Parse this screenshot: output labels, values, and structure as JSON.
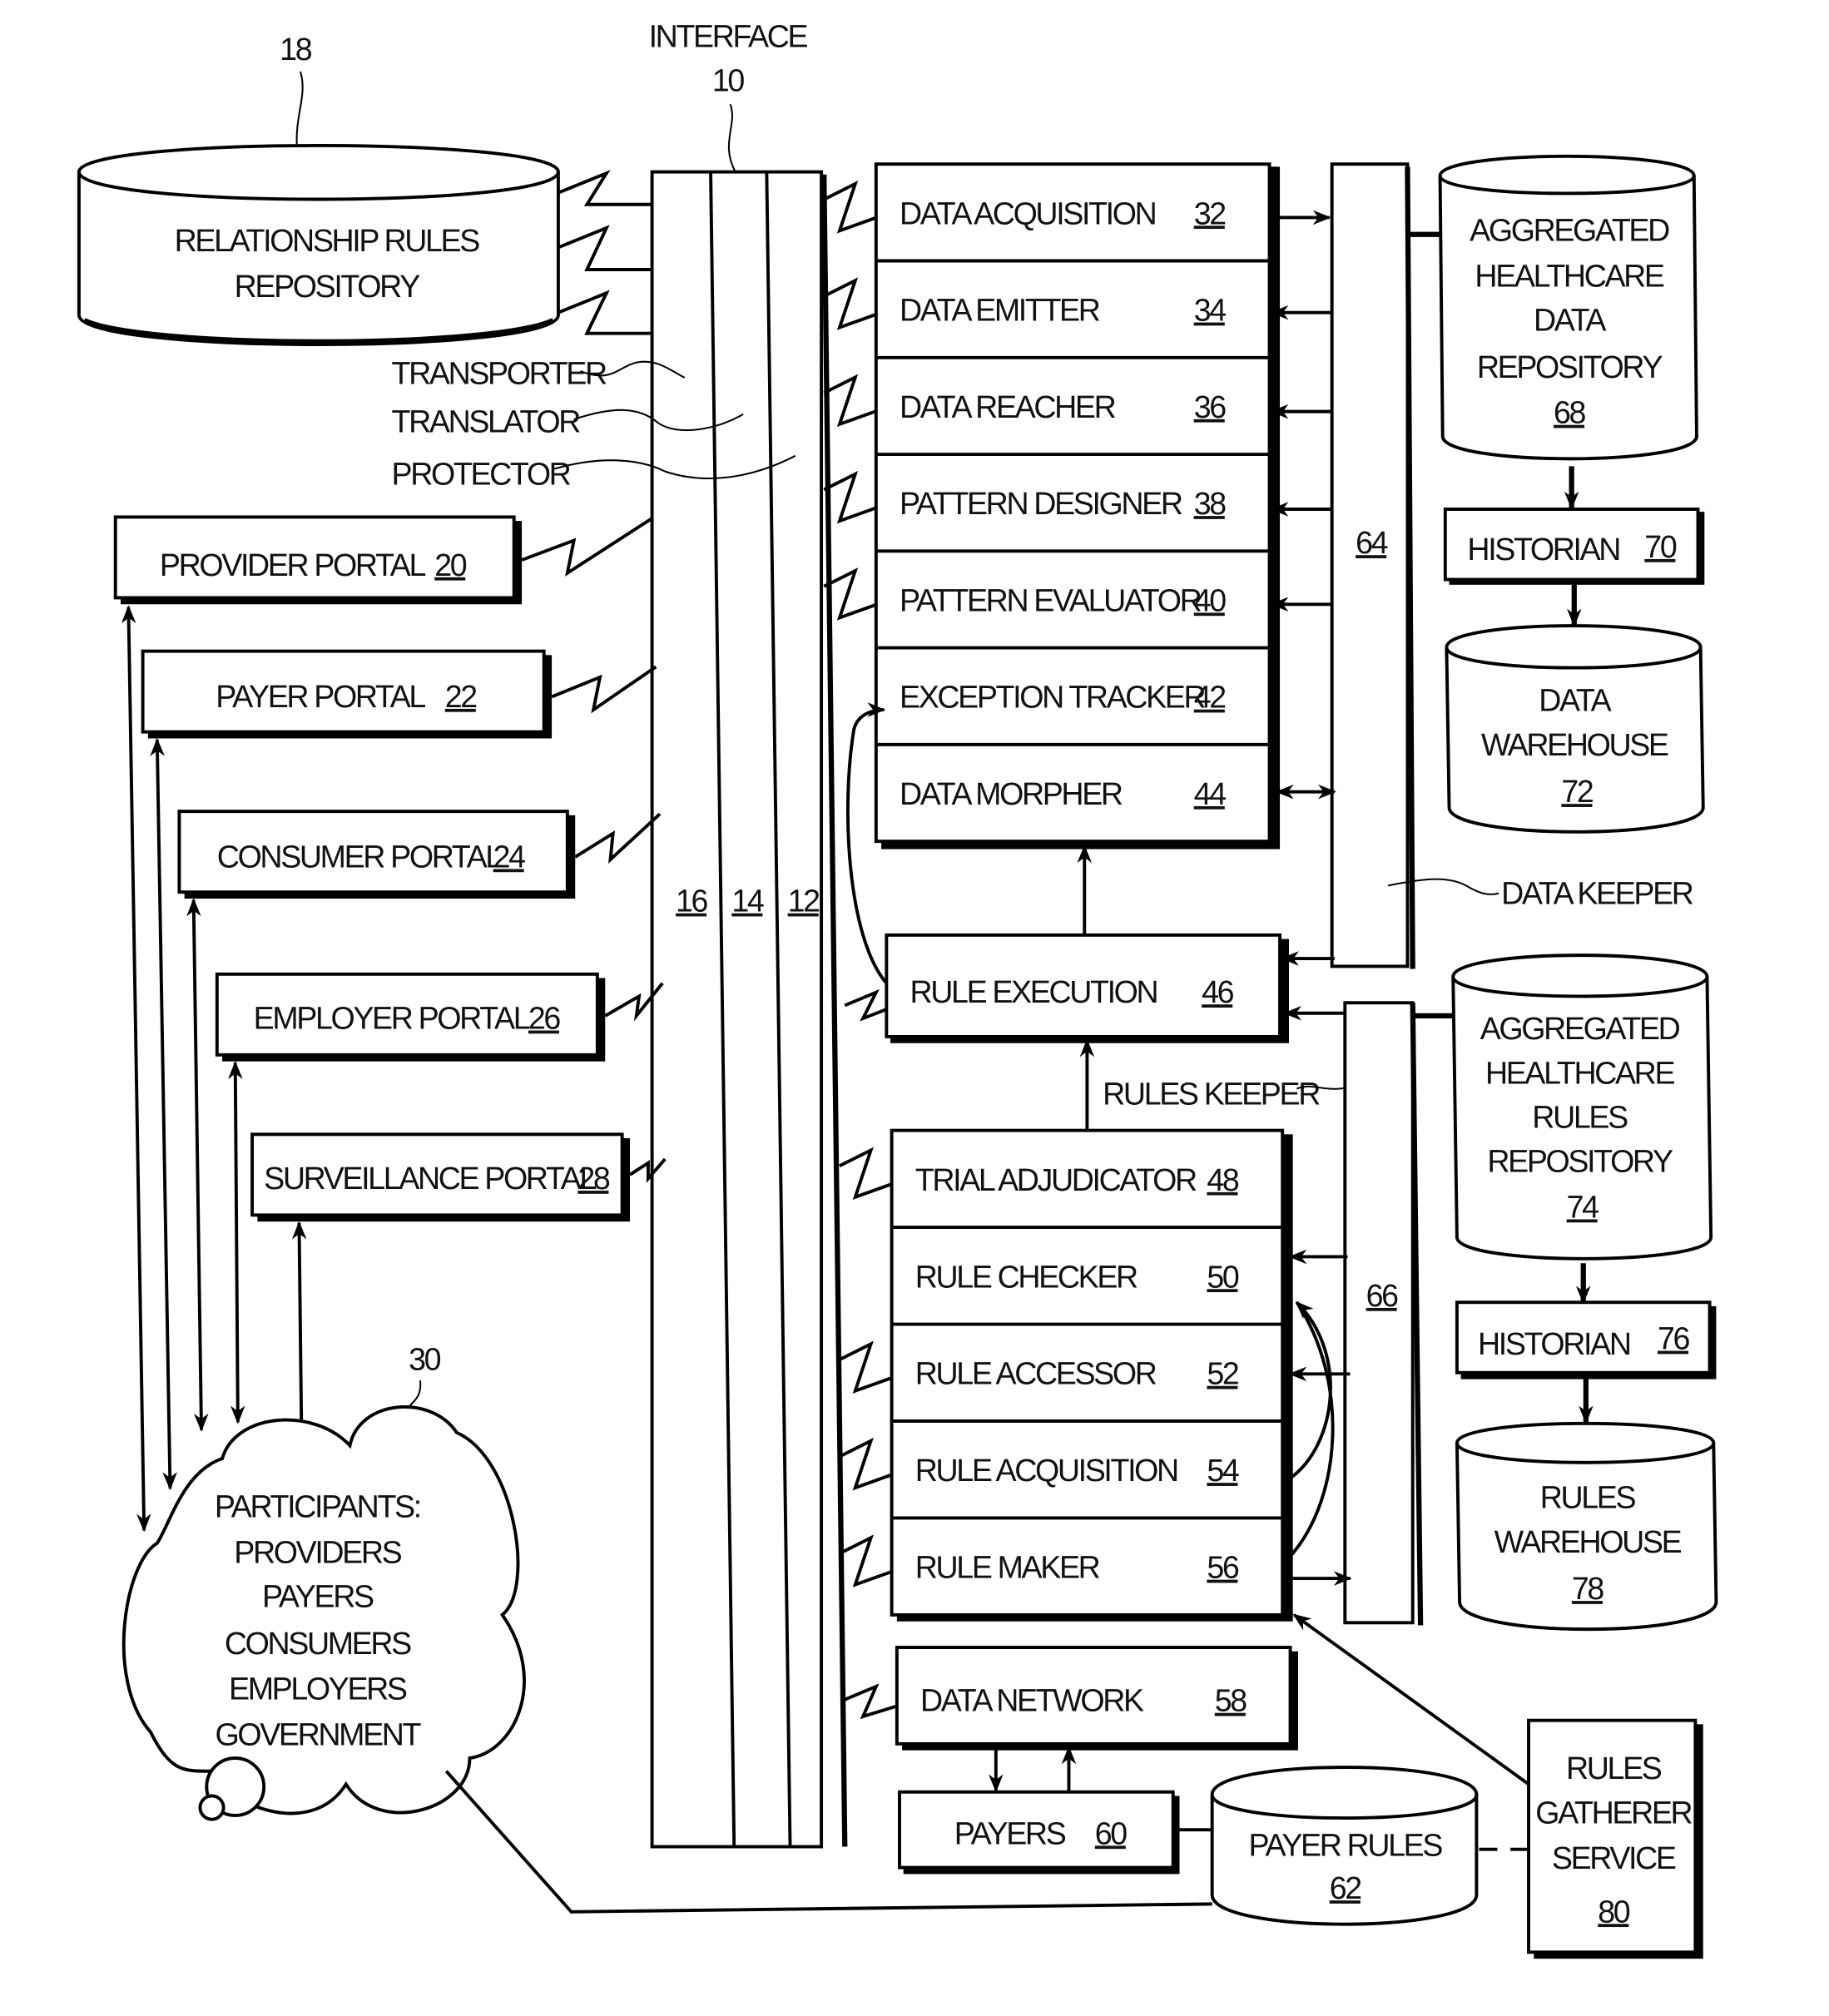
{
  "figure": {
    "interface": {
      "label": "INTERFACE",
      "ref": "10",
      "lanes": [
        "16",
        "14",
        "12"
      ]
    },
    "interface_parts": [
      "TRANSPORTER",
      "TRANSLATOR",
      "PROTECTOR"
    ],
    "relationship_repo": {
      "lines": [
        "RELATIONSHIP RULES",
        "REPOSITORY"
      ],
      "ref": "18"
    },
    "portals": [
      {
        "label": "PROVIDER PORTAL",
        "ref": "20"
      },
      {
        "label": "PAYER PORTAL",
        "ref": "22"
      },
      {
        "label": "CONSUMER PORTAL",
        "ref": "24"
      },
      {
        "label": "EMPLOYER PORTAL",
        "ref": "26"
      },
      {
        "label": "SURVEILLANCE PORTAL",
        "ref": "28"
      }
    ],
    "participants": {
      "ref": "30",
      "lines": [
        "PARTICIPANTS:",
        "PROVIDERS",
        "PAYERS",
        "CONSUMERS",
        "EMPLOYERS",
        "GOVERNMENT"
      ]
    },
    "data_modules": [
      {
        "label": "DATA ACQUISITION",
        "ref": "32"
      },
      {
        "label": "DATA EMITTER",
        "ref": "34"
      },
      {
        "label": "DATA REACHER",
        "ref": "36"
      },
      {
        "label": "PATTERN DESIGNER",
        "ref": "38"
      },
      {
        "label": "PATTERN EVALUATOR",
        "ref": "40"
      },
      {
        "label": "EXCEPTION TRACKER",
        "ref": "42"
      },
      {
        "label": "DATA MORPHER",
        "ref": "44"
      }
    ],
    "rule_execution": {
      "label": "RULE EXECUTION",
      "ref": "46"
    },
    "rules_keeper_label": "RULES KEEPER",
    "data_keeper_label": "DATA KEEPER",
    "rule_modules": [
      {
        "label": "TRIAL ADJUDICATOR",
        "ref": "48"
      },
      {
        "label": "RULE CHECKER",
        "ref": "50"
      },
      {
        "label": "RULE ACCESSOR",
        "ref": "52"
      },
      {
        "label": "RULE ACQUISITION",
        "ref": "54"
      },
      {
        "label": "RULE MAKER",
        "ref": "56"
      }
    ],
    "data_network": {
      "label": "DATA NETWORK",
      "ref": "58"
    },
    "payers": {
      "label": "PAYERS",
      "ref": "60"
    },
    "payer_rules": {
      "label": "PAYER RULES",
      "ref": "62"
    },
    "data_bus": {
      "ref": "64"
    },
    "rules_bus": {
      "ref": "66"
    },
    "agg_data_repo": {
      "lines": [
        "AGGREGATED",
        "HEALTHCARE",
        "DATA",
        "REPOSITORY"
      ],
      "ref": "68"
    },
    "historian_data": {
      "label": "HISTORIAN",
      "ref": "70"
    },
    "data_warehouse": {
      "lines": [
        "DATA",
        "WAREHOUSE"
      ],
      "ref": "72"
    },
    "agg_rules_repo": {
      "lines": [
        "AGGREGATED",
        "HEALTHCARE",
        "RULES",
        "REPOSITORY"
      ],
      "ref": "74"
    },
    "historian_rules": {
      "label": "HISTORIAN",
      "ref": "76"
    },
    "rules_warehouse": {
      "lines": [
        "RULES",
        "WAREHOUSE"
      ],
      "ref": "78"
    },
    "rules_gatherer": {
      "lines": [
        "RULES",
        "GATHERER",
        "SERVICE"
      ],
      "ref": "80"
    }
  }
}
